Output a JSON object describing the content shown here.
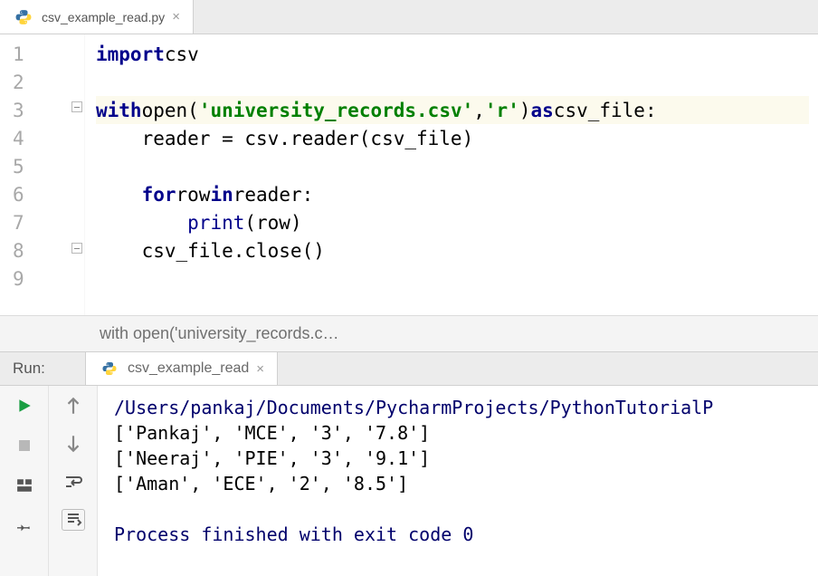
{
  "tab": {
    "filename": "csv_example_read.py"
  },
  "gutter": [
    "1",
    "2",
    "3",
    "4",
    "5",
    "6",
    "7",
    "8",
    "9"
  ],
  "code": {
    "l1": {
      "kw": "import",
      "sp": " ",
      "mod": "csv"
    },
    "l3": {
      "kw1": "with",
      "sp1": " ",
      "fn": "open",
      "p1": "(",
      "s1": "'university_records.csv'",
      "c": ", ",
      "s2": "'r'",
      "p2": ") ",
      "kw2": "as",
      "sp2": " ",
      "var": "csv_file:"
    },
    "l4": {
      "txt": "    reader = csv.reader(csv_file)"
    },
    "l6": {
      "ind": "    ",
      "kw1": "for",
      "sp1": " ",
      "v1": "row ",
      "kw2": "in",
      "sp2": " ",
      "v2": "reader:"
    },
    "l7": {
      "ind": "        ",
      "fn": "print",
      "rest": "(row)"
    },
    "l8": {
      "txt": "    csv_file.close()"
    }
  },
  "breadcrumb": "with open('university_records.c…",
  "run": {
    "label": "Run:",
    "tab": "csv_example_read"
  },
  "console": {
    "path": "/Users/pankaj/Documents/PycharmProjects/PythonTutorialP",
    "rows": [
      "['Pankaj', 'MCE', '3', '7.8']",
      "['Neeraj', 'PIE', '3', '9.1']",
      "['Aman', 'ECE', '2', '8.5']"
    ],
    "exit": "Process finished with exit code 0"
  }
}
